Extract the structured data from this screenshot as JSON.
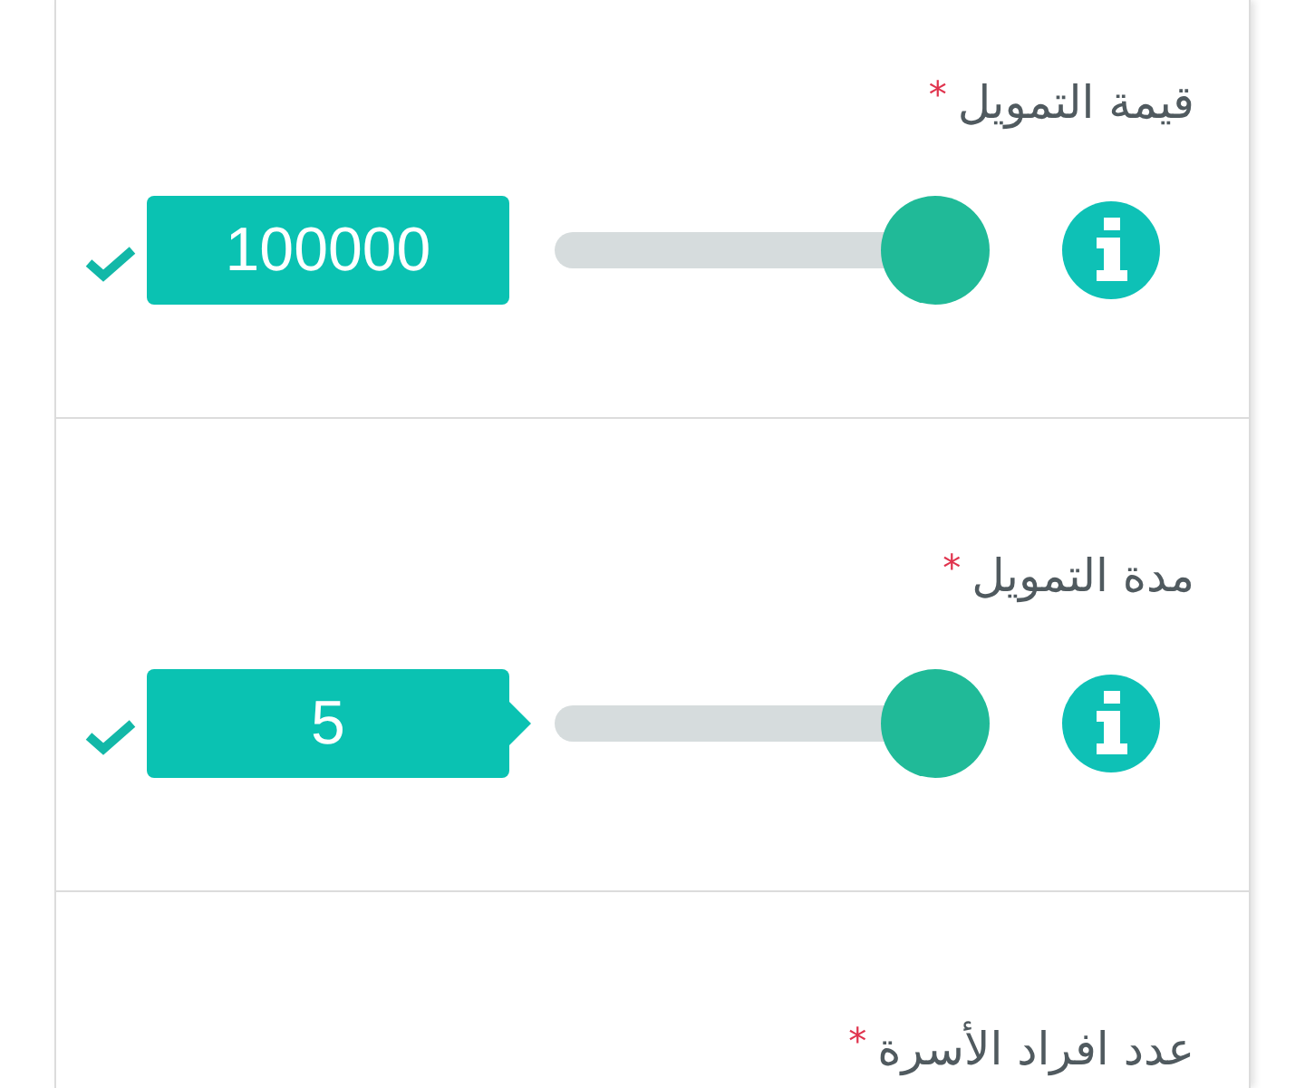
{
  "fields": [
    {
      "label": "قيمة التمويل",
      "required_mark": "*",
      "value": "100000",
      "level": 1,
      "valid": true,
      "pointer": false
    },
    {
      "label": "مدة التمويل",
      "required_mark": "*",
      "value": "5",
      "level": 1,
      "valid": true,
      "pointer": true
    },
    {
      "label": "عدد افراد الأسرة",
      "required_mark": "*"
    }
  ]
}
